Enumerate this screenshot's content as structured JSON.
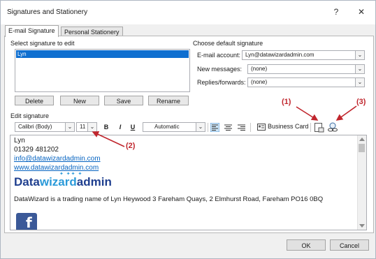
{
  "window": {
    "title": "Signatures and Stationery",
    "help": "?",
    "close": "✕"
  },
  "tabs": [
    {
      "label": "E-mail Signature",
      "active": true
    },
    {
      "label": "Personal Stationery",
      "active": false
    }
  ],
  "select_section": {
    "label": "Select signature to edit",
    "items": [
      "Lyn"
    ],
    "selected": "Lyn",
    "buttons": {
      "delete": "Delete",
      "new": "New",
      "save": "Save",
      "rename": "Rename"
    }
  },
  "default_section": {
    "label": "Choose default signature",
    "email_account_label": "E-mail account:",
    "email_account_value": "Lyn@datawizardadmin.com",
    "new_messages_label": "New messages:",
    "new_messages_value": "(none)",
    "replies_label": "Replies/forwards:",
    "replies_value": "(none)"
  },
  "edit_section": {
    "label": "Edit signature",
    "font_value": "Calibri (Body)",
    "size_value": "11",
    "bold": "B",
    "italic": "I",
    "underline": "U",
    "color_value": "Automatic",
    "business_card": "Business Card"
  },
  "signature": {
    "name": "Lyn",
    "phone": "01329 481202",
    "email": "info@datawizardadmin.com",
    "website": "www.datawizardadmin.com",
    "logo_part1": "Data",
    "logo_part2": "wizard",
    "logo_part3": "admin",
    "footer": "DataWizard is a trading name of Lyn Heywood 3 Fareham Quays, 2 Elmhurst Road, Fareham PO16 0BQ"
  },
  "annotations": {
    "a1": "(1)",
    "a2": "(2)",
    "a3": "(3)"
  },
  "footer": {
    "ok": "OK",
    "cancel": "Cancel"
  },
  "colors": {
    "accent": "#0f6fd0",
    "annotation": "#c0262d",
    "link": "#0563c1"
  }
}
